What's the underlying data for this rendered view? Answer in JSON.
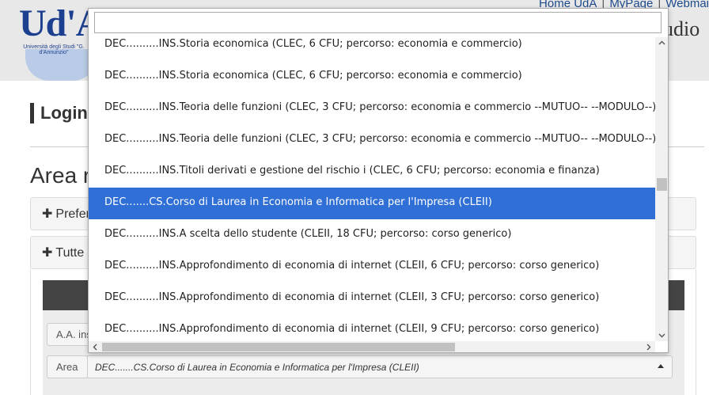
{
  "header": {
    "logo_text": "Ud'A",
    "logo_subtext": "Università degli Studi \"G. d'Annunzio\"",
    "top_links": [
      "Home UdA",
      "MyPage",
      "Webmai"
    ],
    "site_title_fragment": "udio"
  },
  "page": {
    "login_title": "Login",
    "area_title": "Area r",
    "panel_1_label": "Prefer",
    "panel_2_label": "Tutte",
    "aa_label": "A.A. ins",
    "area_label": "Area",
    "area_selected_value": "DEC.......CS.Corso di Laurea in Economia e Informatica per l'Impresa (CLEII)"
  },
  "dropdown": {
    "search_value": "",
    "options": [
      {
        "label": "DEC..........INS.Storia economica (CLEC, 6 CFU; percorso: economia e commercio)",
        "selected": false
      },
      {
        "label": "DEC..........INS.Storia economica (CLEC, 6 CFU; percorso: economia e commercio)",
        "selected": false
      },
      {
        "label": "DEC..........INS.Teoria delle funzioni (CLEC, 3 CFU; percorso: economia e commercio --MUTUO-- --MODULO--)",
        "selected": false
      },
      {
        "label": "DEC..........INS.Teoria delle funzioni (CLEC, 3 CFU; percorso: economia e commercio --MUTUO-- --MODULO--)",
        "selected": false
      },
      {
        "label": "DEC..........INS.Titoli derivati e gestione del rischio i (CLEC, 6 CFU; percorso: economia e finanza)",
        "selected": false
      },
      {
        "label": "DEC.......CS.Corso di Laurea in Economia e Informatica per l'Impresa (CLEII)",
        "selected": true
      },
      {
        "label": "DEC..........INS.A scelta dello studente (CLEII, 18 CFU; percorso: corso generico)",
        "selected": false
      },
      {
        "label": "DEC..........INS.Approfondimento di economia di internet (CLEII, 6 CFU; percorso: corso generico)",
        "selected": false
      },
      {
        "label": "DEC..........INS.Approfondimento di economia di internet (CLEII, 3 CFU; percorso: corso generico)",
        "selected": false
      },
      {
        "label": "DEC..........INS.Approfondimento di economia di internet (CLEII, 9 CFU; percorso: corso generico)",
        "selected": false
      }
    ]
  },
  "colors": {
    "selected_bg": "#2f6fd6",
    "selected_text": "#ffffff",
    "link": "#1d4a8c",
    "dark_bar": "#444444"
  }
}
